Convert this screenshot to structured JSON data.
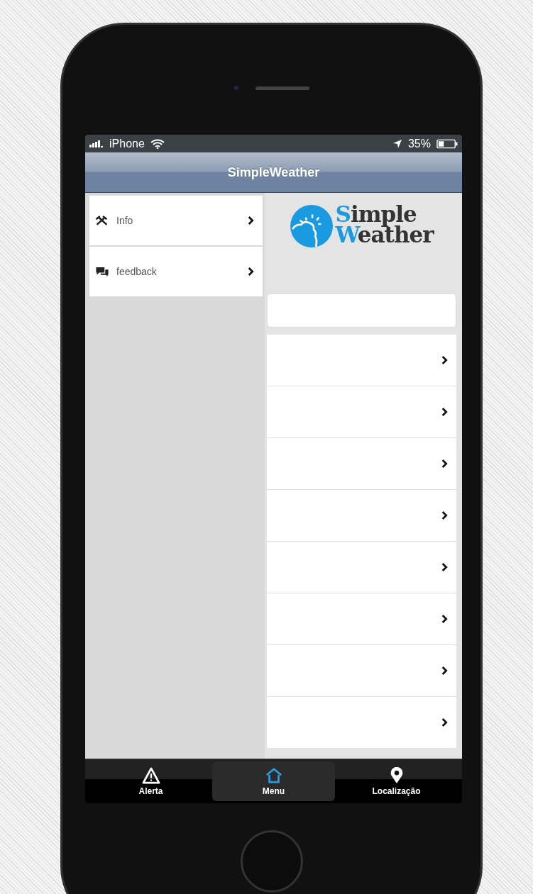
{
  "status_bar": {
    "carrier": "iPhone",
    "battery": "35%"
  },
  "title_bar": {
    "title": "SimpleWeather"
  },
  "side_menu": {
    "items": [
      {
        "label": "Info"
      },
      {
        "label": "feedback"
      }
    ]
  },
  "logo": {
    "line_1": "Simple",
    "line_2": "Weather"
  },
  "list_rows": [
    {
      "kind": "link"
    },
    {
      "kind": "link"
    },
    {
      "kind": "link"
    },
    {
      "kind": "link"
    },
    {
      "kind": "link"
    },
    {
      "kind": "link"
    },
    {
      "kind": "link"
    },
    {
      "kind": "link"
    }
  ],
  "tab_bar": {
    "tabs": [
      {
        "label": "Alerta",
        "selected": false
      },
      {
        "label": "Menu",
        "selected": true
      },
      {
        "label": "Localização",
        "selected": false
      }
    ]
  }
}
